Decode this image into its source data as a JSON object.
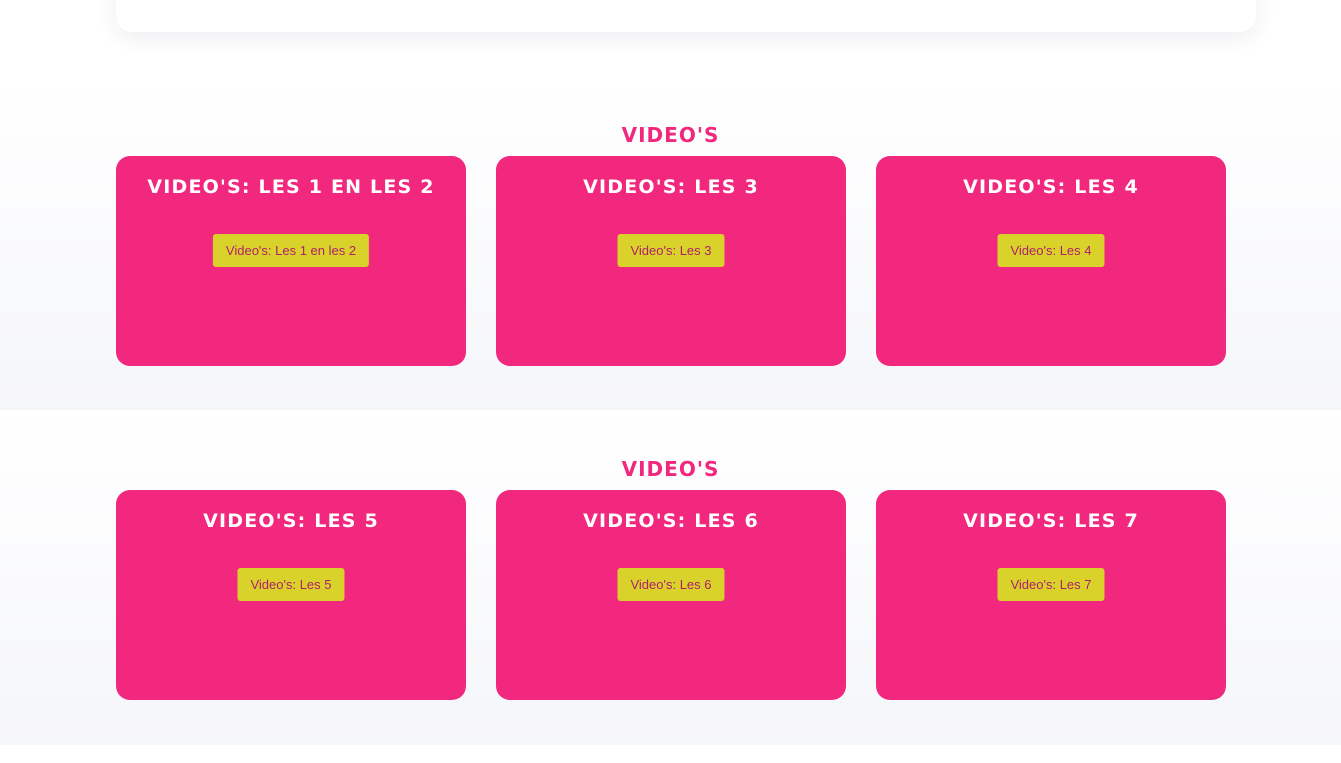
{
  "sections": [
    {
      "title": "VIDEO'S",
      "cards": [
        {
          "title": "VIDEO'S: LES 1 EN LES 2",
          "button": "Video's: Les 1 en les 2"
        },
        {
          "title": "VIDEO'S: LES 3",
          "button": "Video's: Les 3"
        },
        {
          "title": "VIDEO'S: LES 4",
          "button": "Video's: Les 4"
        }
      ]
    },
    {
      "title": "VIDEO'S",
      "cards": [
        {
          "title": "VIDEO'S: LES 5",
          "button": "Video's: Les 5"
        },
        {
          "title": "VIDEO'S: LES 6",
          "button": "Video's: Les 6"
        },
        {
          "title": "VIDEO'S: LES 7",
          "button": "Video's: Les 7"
        }
      ]
    }
  ],
  "colors": {
    "card_background": "#f2277e",
    "button_background": "#d9d22b",
    "button_text": "#b0206a",
    "section_title": "#f2277e"
  }
}
